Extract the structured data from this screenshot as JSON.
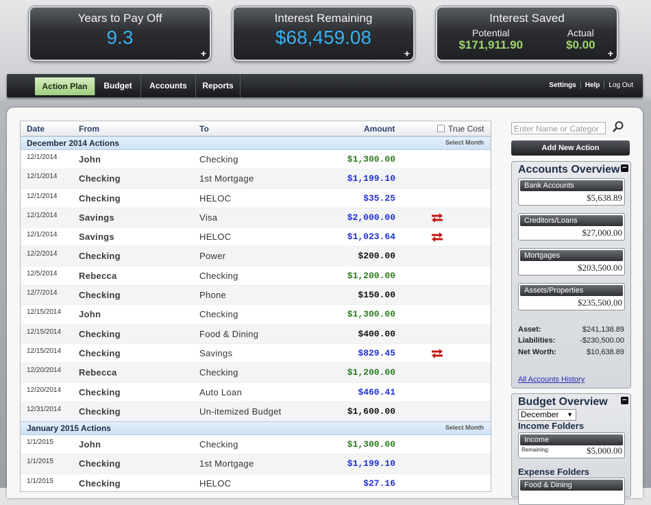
{
  "summary": {
    "years": {
      "title": "Years to Pay Off",
      "value": "9.3"
    },
    "remaining": {
      "title": "Interest Remaining",
      "value": "$68,459.08"
    },
    "saved": {
      "title": "Interest Saved",
      "potential_label": "Potential",
      "potential_value": "$171,911.90",
      "actual_label": "Actual",
      "actual_value": "$0.00"
    },
    "plus": "+"
  },
  "nav": {
    "tabs": [
      "Action Plan",
      "Budget",
      "Accounts",
      "Reports"
    ],
    "active": "Action Plan",
    "right": [
      "Settings",
      "Help",
      "Log Out"
    ]
  },
  "table": {
    "headers": {
      "date": "Date",
      "from": "From",
      "to": "To",
      "amount": "Amount",
      "true_cost": "True Cost"
    },
    "select_month": "Select Month",
    "sections": [
      {
        "title": "December 2014 Actions",
        "rows": [
          {
            "date": "12/1/2014",
            "from": "John",
            "to": "Checking",
            "amount": "$1,300.00",
            "color": "green",
            "transfer": false
          },
          {
            "date": "12/1/2014",
            "from": "Checking",
            "to": "1st Mortgage",
            "amount": "$1,199.10",
            "color": "blue",
            "transfer": false
          },
          {
            "date": "12/1/2014",
            "from": "Checking",
            "to": "HELOC",
            "amount": "$35.25",
            "color": "blue",
            "transfer": false
          },
          {
            "date": "12/1/2014",
            "from": "Savings",
            "to": "Visa",
            "amount": "$2,000.00",
            "color": "blue",
            "transfer": true
          },
          {
            "date": "12/1/2014",
            "from": "Savings",
            "to": "HELOC",
            "amount": "$1,023.64",
            "color": "blue",
            "transfer": true
          },
          {
            "date": "12/2/2014",
            "from": "Checking",
            "to": "Power",
            "amount": "$200.00",
            "color": "black",
            "transfer": false
          },
          {
            "date": "12/5/2014",
            "from": "Rebecca",
            "to": "Checking",
            "amount": "$1,200.00",
            "color": "green",
            "transfer": false
          },
          {
            "date": "12/7/2014",
            "from": "Checking",
            "to": "Phone",
            "amount": "$150.00",
            "color": "black",
            "transfer": false
          },
          {
            "date": "12/15/2014",
            "from": "John",
            "to": "Checking",
            "amount": "$1,300.00",
            "color": "green",
            "transfer": false
          },
          {
            "date": "12/15/2014",
            "from": "Checking",
            "to": "Food & Dining",
            "amount": "$400.00",
            "color": "black",
            "transfer": false
          },
          {
            "date": "12/15/2014",
            "from": "Checking",
            "to": "Savings",
            "amount": "$829.45",
            "color": "blue",
            "transfer": true
          },
          {
            "date": "12/20/2014",
            "from": "Rebecca",
            "to": "Checking",
            "amount": "$1,200.00",
            "color": "green",
            "transfer": false
          },
          {
            "date": "12/20/2014",
            "from": "Checking",
            "to": "Auto Loan",
            "amount": "$460.41",
            "color": "blue",
            "transfer": false
          },
          {
            "date": "12/31/2014",
            "from": "Checking",
            "to": "Un-itemized Budget",
            "amount": "$1,600.00",
            "color": "black",
            "transfer": false
          }
        ]
      },
      {
        "title": "January 2015 Actions",
        "rows": [
          {
            "date": "1/1/2015",
            "from": "John",
            "to": "Checking",
            "amount": "$1,300.00",
            "color": "green",
            "transfer": false
          },
          {
            "date": "1/1/2015",
            "from": "Checking",
            "to": "1st Mortgage",
            "amount": "$1,199.10",
            "color": "blue",
            "transfer": false
          },
          {
            "date": "1/1/2015",
            "from": "Checking",
            "to": "HELOC",
            "amount": "$27.16",
            "color": "blue",
            "transfer": false
          }
        ]
      }
    ]
  },
  "sidebar": {
    "search_placeholder": "Enter Name or Categor",
    "add_action": "Add New Action",
    "accounts": {
      "title": "Accounts Overview",
      "cards": [
        {
          "label": "Bank Accounts",
          "value": "$5,638.89"
        },
        {
          "label": "Creditors/Loans",
          "value": "$27,000.00"
        },
        {
          "label": "Mortgages",
          "value": "$203,500.00"
        },
        {
          "label": "Assets/Properties",
          "value": "$235,500.00"
        }
      ],
      "totals": [
        {
          "label": "Asset:",
          "value": "$241,138.89"
        },
        {
          "label": "Liabilities:",
          "value": "-$230,500.00"
        },
        {
          "label": "Net Worth:",
          "value": "$10,638.89"
        }
      ],
      "history_link": "All Accounts History"
    },
    "budget": {
      "title": "Budget Overview",
      "month": "December",
      "income_title": "Income Folders",
      "income_card": {
        "label": "Income",
        "remaining_label": "Remaining:",
        "value": "$5,000.00"
      },
      "expense_title": "Expense Folders",
      "expense_card": {
        "label": "Food & Dining"
      }
    }
  },
  "colors": {
    "green": "#2a7a1c",
    "blue": "#1f2fd8",
    "black": "#111111",
    "accent_blue": "#3ab0f0",
    "saved_green": "#9fd46a"
  }
}
